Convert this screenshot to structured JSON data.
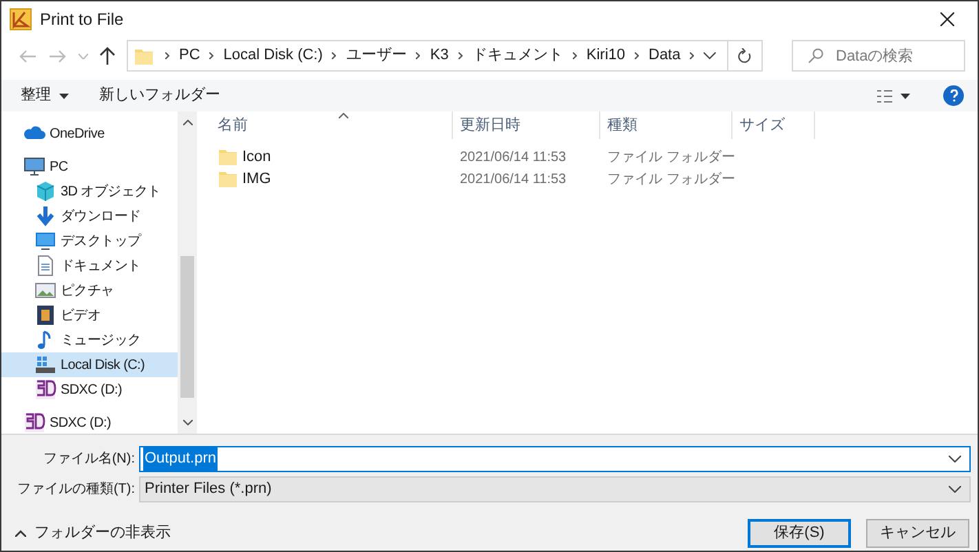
{
  "window": {
    "title": "Print to File"
  },
  "address": {
    "segments": [
      "PC",
      "Local Disk (C:)",
      "ユーザー",
      "K3",
      "ドキュメント",
      "Kiri10",
      "Data"
    ]
  },
  "search": {
    "placeholder": "Dataの検索"
  },
  "toolbar": {
    "organize": "整理",
    "new_folder": "新しいフォルダー"
  },
  "sidebar": {
    "items": [
      {
        "label": "OneDrive",
        "kind": "cloud",
        "selected": false
      },
      {
        "label": "PC",
        "kind": "pc",
        "selected": false,
        "children": [
          {
            "label": "3D オブジェクト",
            "kind": "cube",
            "selected": false
          },
          {
            "label": "ダウンロード",
            "kind": "download",
            "selected": false
          },
          {
            "label": "デスクトップ",
            "kind": "desktop",
            "selected": false
          },
          {
            "label": "ドキュメント",
            "kind": "document",
            "selected": false
          },
          {
            "label": "ピクチャ",
            "kind": "pictures",
            "selected": false
          },
          {
            "label": "ビデオ",
            "kind": "video",
            "selected": false
          },
          {
            "label": "ミュージック",
            "kind": "music",
            "selected": false
          },
          {
            "label": "Local Disk (C:)",
            "kind": "drive",
            "selected": true
          },
          {
            "label": "SDXC (D:)",
            "kind": "sd",
            "selected": false
          }
        ]
      },
      {
        "label": "SDXC (D:)",
        "kind": "sd",
        "selected": false
      }
    ]
  },
  "table": {
    "columns": [
      "名前",
      "更新日時",
      "種類",
      "サイズ"
    ],
    "rows": [
      {
        "name": "Icon",
        "modified": "2021/06/14 11:53",
        "type": "ファイル フォルダー"
      },
      {
        "name": "IMG",
        "modified": "2021/06/14 11:53",
        "type": "ファイル フォルダー"
      }
    ]
  },
  "filename": {
    "label": "ファイル名(N):",
    "value": "Output.prn",
    "text_selected": true
  },
  "filetype": {
    "label": "ファイルの種類(T):",
    "value": "Printer Files (*.prn)"
  },
  "hide_folders": "フォルダーの非表示",
  "buttons": [
    {
      "label": "保存(S)",
      "default": true
    },
    {
      "label": "キャンセル",
      "default": false
    }
  ]
}
